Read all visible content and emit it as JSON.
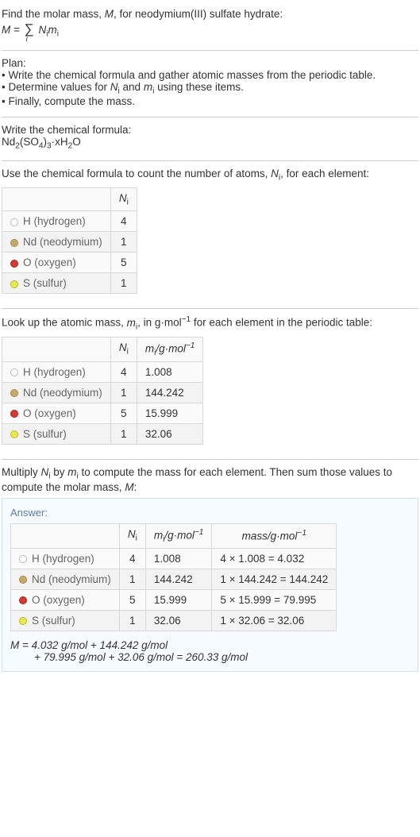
{
  "intro": {
    "line1": "Find the molar mass, M, for neodymium(III) sulfate hydrate:",
    "formula_prefix": "M = ",
    "formula_sum": "∑",
    "formula_body": " N",
    "formula_sub_i": "i",
    "formula_m": "m",
    "formula_sub_i2": "i"
  },
  "plan": {
    "title": "Plan:",
    "bullets": [
      "• Write the chemical formula and gather atomic masses from the periodic table.",
      "• Determine values for Nᵢ and mᵢ using these items.",
      "• Finally, compute the mass."
    ]
  },
  "chem": {
    "title": "Write the chemical formula:",
    "formula": "Nd₂(SO₄)₃·xH₂O"
  },
  "count": {
    "title_a": "Use the chemical formula to count the number of atoms, ",
    "title_ni": "N",
    "title_sub": "i",
    "title_b": ", for each element:",
    "header_ni": "Nᵢ",
    "rows": [
      {
        "circle": "c-h",
        "sym": "H",
        "name": "(hydrogen)",
        "ni": "4"
      },
      {
        "circle": "c-nd",
        "sym": "Nd",
        "name": "(neodymium)",
        "ni": "1"
      },
      {
        "circle": "c-o",
        "sym": "O",
        "name": "(oxygen)",
        "ni": "5"
      },
      {
        "circle": "c-s",
        "sym": "S",
        "name": "(sulfur)",
        "ni": "1"
      }
    ]
  },
  "mass": {
    "title_a": "Look up the atomic mass, ",
    "title_mi": "m",
    "title_sub": "i",
    "title_b": ", in g·mol",
    "title_sup": "−1",
    "title_c": " for each element in the periodic table:",
    "header_ni": "Nᵢ",
    "header_mi": "mᵢ/g·mol⁻¹",
    "rows": [
      {
        "circle": "c-h",
        "sym": "H",
        "name": "(hydrogen)",
        "ni": "4",
        "mi": "1.008"
      },
      {
        "circle": "c-nd",
        "sym": "Nd",
        "name": "(neodymium)",
        "ni": "1",
        "mi": "144.242"
      },
      {
        "circle": "c-o",
        "sym": "O",
        "name": "(oxygen)",
        "ni": "5",
        "mi": "15.999"
      },
      {
        "circle": "c-s",
        "sym": "S",
        "name": "(sulfur)",
        "ni": "1",
        "mi": "32.06"
      }
    ]
  },
  "mult": {
    "text": "Multiply Nᵢ by mᵢ to compute the mass for each element. Then sum those values to compute the molar mass, M:"
  },
  "answer": {
    "label": "Answer:",
    "header_ni": "Nᵢ",
    "header_mi": "mᵢ/g·mol⁻¹",
    "header_mass": "mass/g·mol⁻¹",
    "rows": [
      {
        "circle": "c-h",
        "sym": "H",
        "name": "(hydrogen)",
        "ni": "4",
        "mi": "1.008",
        "mass": "4 × 1.008 = 4.032"
      },
      {
        "circle": "c-nd",
        "sym": "Nd",
        "name": "(neodymium)",
        "ni": "1",
        "mi": "144.242",
        "mass": "1 × 144.242 = 144.242"
      },
      {
        "circle": "c-o",
        "sym": "O",
        "name": "(oxygen)",
        "ni": "5",
        "mi": "15.999",
        "mass": "5 × 15.999 = 79.995"
      },
      {
        "circle": "c-s",
        "sym": "S",
        "name": "(sulfur)",
        "ni": "1",
        "mi": "32.06",
        "mass": "1 × 32.06 = 32.06"
      }
    ],
    "eq_l1": "M = 4.032 g/mol + 144.242 g/mol",
    "eq_l2": "+ 79.995 g/mol + 32.06 g/mol = 260.33 g/mol"
  }
}
